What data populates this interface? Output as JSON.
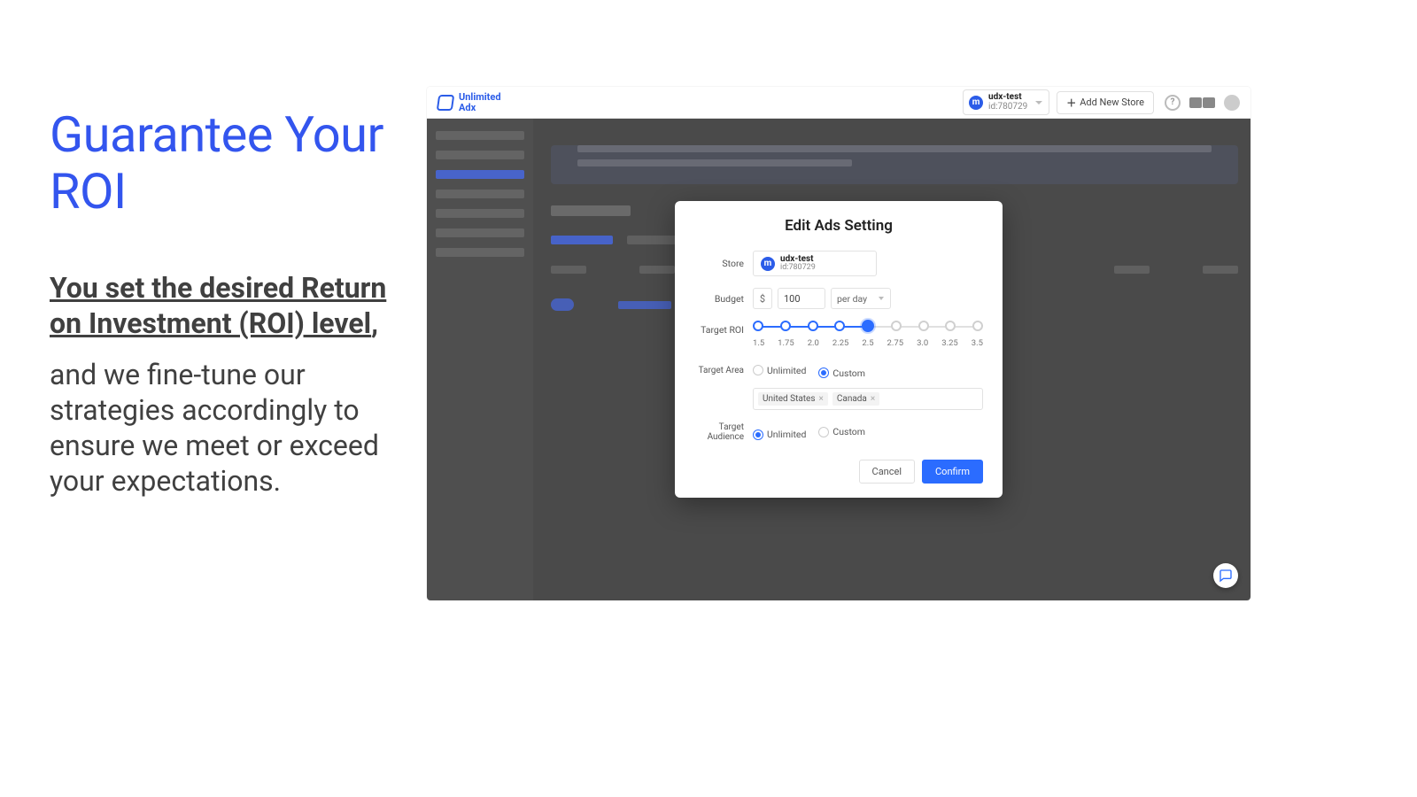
{
  "left": {
    "headline": "Guarantee Your ROI",
    "subhead": "You set the desired Return on Investment (ROI) level",
    "comma": ",",
    "body": "and we fine-tune our strategies accordingly to ensure we meet or exceed your expectations."
  },
  "app": {
    "brand_line1": "Unlimited",
    "brand_line2": "Adx",
    "store": {
      "avatar": "m",
      "name": "udx-test",
      "id": "id:780729"
    },
    "add_store": "Add New Store"
  },
  "modal": {
    "title": "Edit Ads Setting",
    "labels": {
      "store": "Store",
      "budget": "Budget",
      "roi": "Target ROI",
      "area": "Target Area",
      "audience": "Target Audience"
    },
    "store": {
      "avatar": "m",
      "name": "udx-test",
      "id": "id:780729"
    },
    "budget": {
      "currency": "$",
      "amount": "100",
      "period": "per day"
    },
    "roi": {
      "ticks": [
        "1.5",
        "1.75",
        "2.0",
        "2.25",
        "2.5",
        "2.75",
        "3.0",
        "3.25",
        "3.5"
      ],
      "selected_index": 4
    },
    "target_area": {
      "options": [
        "Unlimited",
        "Custom"
      ],
      "selected": "Custom",
      "tags": [
        "United States",
        "Canada"
      ]
    },
    "target_audience": {
      "options": [
        "Unlimited",
        "Custom"
      ],
      "selected": "Unlimited"
    },
    "buttons": {
      "cancel": "Cancel",
      "confirm": "Confirm"
    }
  }
}
